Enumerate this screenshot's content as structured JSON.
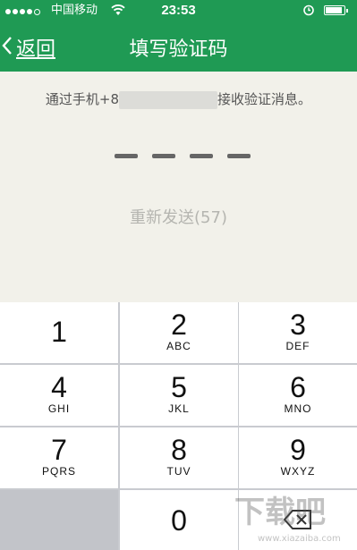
{
  "status_bar": {
    "carrier": "中国移动",
    "time": "23:53",
    "signal_bars_filled": 4,
    "signal_bars_total": 5,
    "battery_level": 0.9
  },
  "nav": {
    "back_label": "返回",
    "title": "填写验证码"
  },
  "prompt": {
    "prefix": "通过手机+8",
    "suffix": "接收验证消息。"
  },
  "code": {
    "slots": 4
  },
  "resend_label": "重新发送(57)",
  "keypad": {
    "keys": [
      {
        "digit": "1",
        "letters": ""
      },
      {
        "digit": "2",
        "letters": "ABC"
      },
      {
        "digit": "3",
        "letters": "DEF"
      },
      {
        "digit": "4",
        "letters": "GHI"
      },
      {
        "digit": "5",
        "letters": "JKL"
      },
      {
        "digit": "6",
        "letters": "MNO"
      },
      {
        "digit": "7",
        "letters": "PQRS"
      },
      {
        "digit": "8",
        "letters": "TUV"
      },
      {
        "digit": "9",
        "letters": "WXYZ"
      },
      {
        "digit": "",
        "letters": ""
      },
      {
        "digit": "0",
        "letters": ""
      },
      {
        "digit": "",
        "letters": ""
      }
    ]
  },
  "watermark": {
    "main": "下载吧",
    "sub": "www.xiazaiba.com"
  },
  "colors": {
    "header": "#1f9a54",
    "background": "#f2f1ea",
    "keypad_gap": "#c9cbd0"
  }
}
